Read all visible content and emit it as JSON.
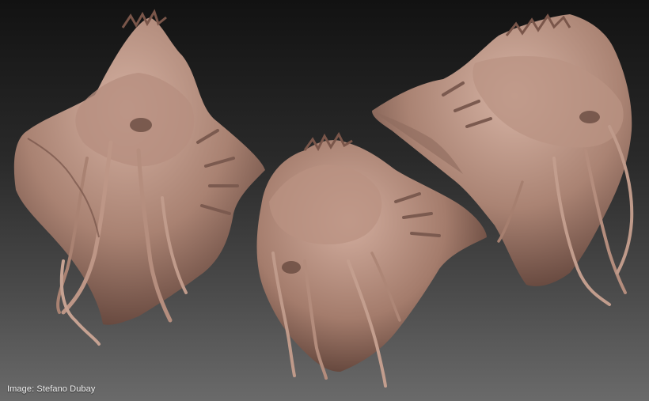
{
  "image": {
    "credit": "Image: Stefano Dubay",
    "colors": {
      "background_top": "#121212",
      "background_bottom": "#6a6a6a",
      "clay_light": "#c9a596",
      "clay_mid": "#a77f70",
      "clay_dark": "#6b4a40"
    }
  }
}
